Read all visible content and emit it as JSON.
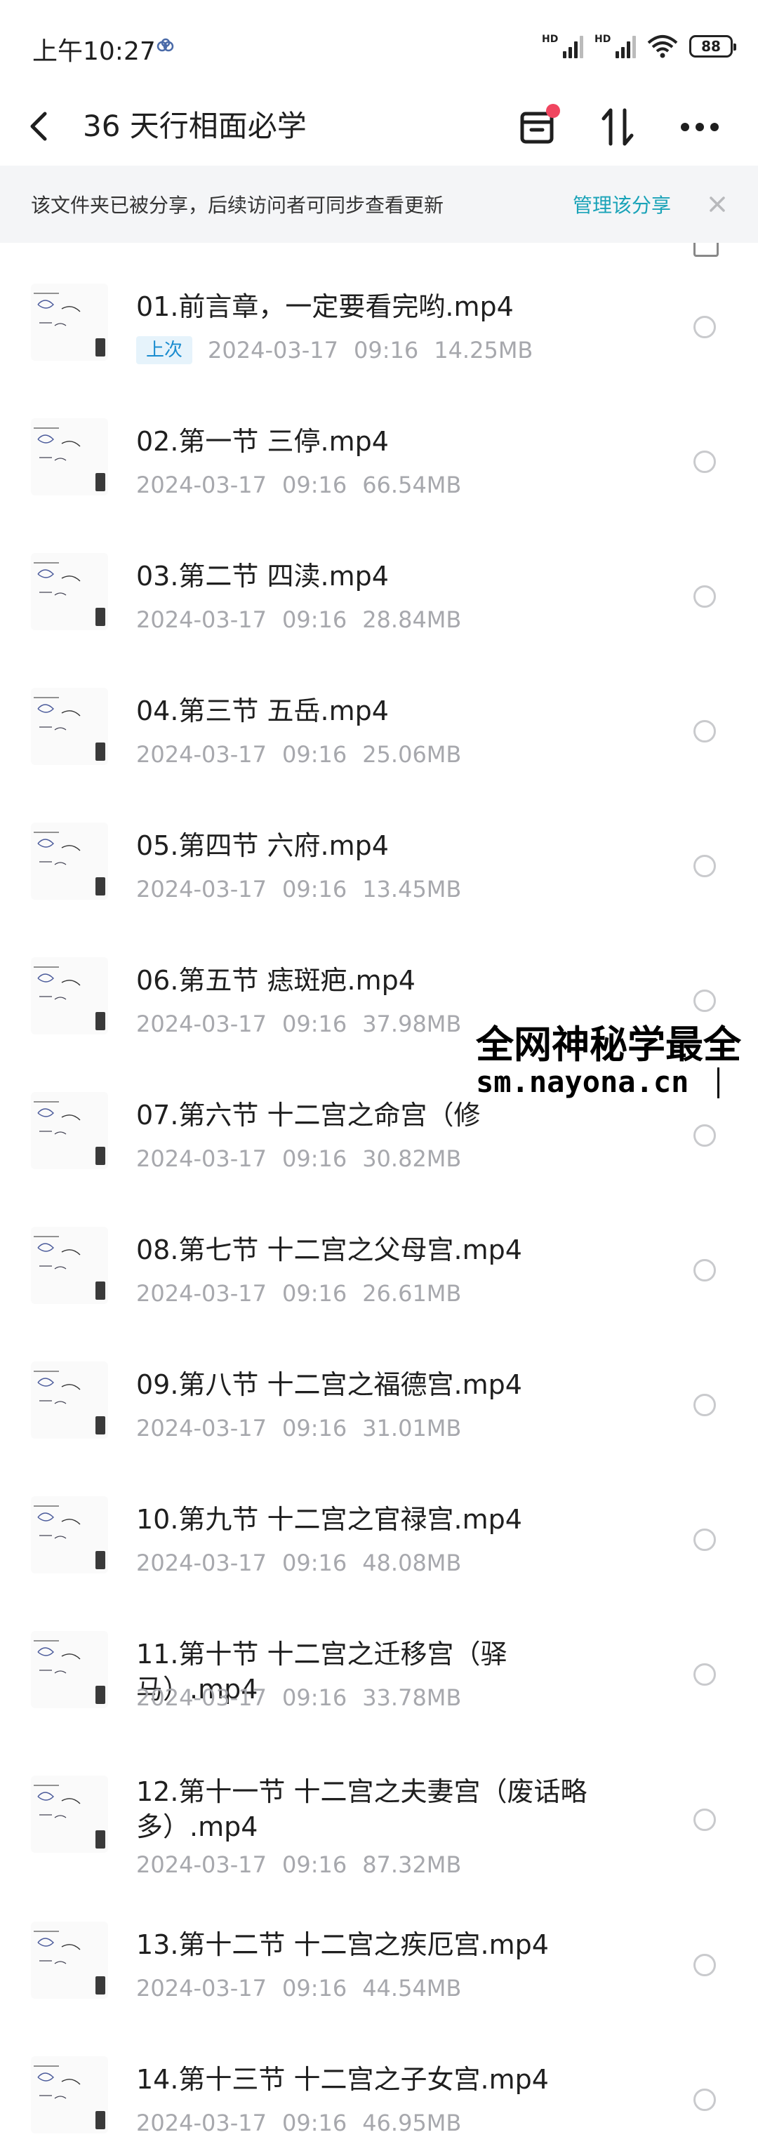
{
  "status_bar": {
    "time": "上午10:27",
    "battery": "88",
    "hd_label": "HD"
  },
  "nav": {
    "title": "36 天行相面必学"
  },
  "share_banner": {
    "text": "该文件夹已被分享，后续访问者可同步查看更新",
    "manage_label": "管理该分享"
  },
  "last_badge": "上次",
  "files": [
    {
      "name": "01.前言章，一定要看完哟.mp4",
      "date": "2024-03-17",
      "time": "09:16",
      "size": "14.25MB",
      "last": true
    },
    {
      "name": "02.第一节 三停.mp4",
      "date": "2024-03-17",
      "time": "09:16",
      "size": "66.54MB"
    },
    {
      "name": "03.第二节 四渎.mp4",
      "date": "2024-03-17",
      "time": "09:16",
      "size": "28.84MB"
    },
    {
      "name": "04.第三节 五岳.mp4",
      "date": "2024-03-17",
      "time": "09:16",
      "size": "25.06MB"
    },
    {
      "name": "05.第四节 六府.mp4",
      "date": "2024-03-17",
      "time": "09:16",
      "size": "13.45MB"
    },
    {
      "name": "06.第五节 痣斑疤.mp4",
      "date": "2024-03-17",
      "time": "09:16",
      "size": "37.98MB"
    },
    {
      "name": "07.第六节 十二宫之命宫（修",
      "date": "2024-03-17",
      "time": "09:16",
      "size": "30.82MB"
    },
    {
      "name": "08.第七节 十二宫之父母宫.mp4",
      "date": "2024-03-17",
      "time": "09:16",
      "size": "26.61MB"
    },
    {
      "name": "09.第八节 十二宫之福德宫.mp4",
      "date": "2024-03-17",
      "time": "09:16",
      "size": "31.01MB"
    },
    {
      "name": "10.第九节 十二宫之官禄宫.mp4",
      "date": "2024-03-17",
      "time": "09:16",
      "size": "48.08MB"
    },
    {
      "name": "11.第十节 十二宫之迁移宫（驿马）.mp4",
      "date": "2024-03-17",
      "time": "09:16",
      "size": "33.78MB"
    },
    {
      "name": "12.第十一节 十二宫之夫妻宫（废话略多）.mp4",
      "date": "2024-03-17",
      "time": "09:16",
      "size": "87.32MB"
    },
    {
      "name": "13.第十二节 十二宫之疾厄宫.mp4",
      "date": "2024-03-17",
      "time": "09:16",
      "size": "44.54MB"
    },
    {
      "name": "14.第十三节 十二宫之子女宫.mp4",
      "date": "2024-03-17",
      "time": "09:16",
      "size": "46.95MB"
    }
  ],
  "watermark": {
    "line1": "全网神秘学最全",
    "line2": "sm.nayona.cn"
  },
  "icons": {
    "back": "chevron-left-icon",
    "inbox": "inbox-icon",
    "sort": "sort-icon",
    "more": "more-icon",
    "close": "close-icon"
  },
  "colors": {
    "accent": "#1aa3b8",
    "badge_text": "#1a8ccf",
    "badge_bg": "#e6f3fb",
    "notify_dot": "#f0455f",
    "meta_text": "#a7a8ad"
  }
}
